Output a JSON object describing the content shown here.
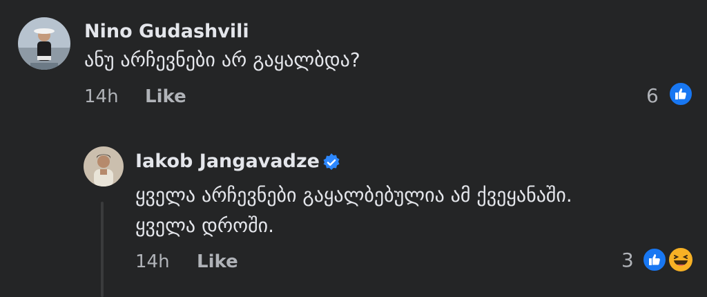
{
  "comments": [
    {
      "author": "Nino Gudashvili",
      "text": "ანუ არჩევნები არ გაყალბდა?",
      "time": "14h",
      "like_label": "Like",
      "reaction_count": "6",
      "reactions": [
        "like-icon"
      ]
    }
  ],
  "replies": [
    {
      "author": "Iakob Jangavadze",
      "verified": true,
      "text_line1": "ყველა არჩევნები გაყალბებულია ამ ქვეყანაში.",
      "text_line2": "ყველა დროში.",
      "time": "14h",
      "like_label": "Like",
      "reaction_count": "3",
      "reactions": [
        "like-icon",
        "haha-icon"
      ]
    }
  ],
  "colors": {
    "background": "#242526",
    "text": "#e4e6eb",
    "secondary_text": "#b0b3b8",
    "like_blue": "#1877f2",
    "verified_blue": "#2d88ff",
    "haha_yellow": "#f7b125"
  }
}
